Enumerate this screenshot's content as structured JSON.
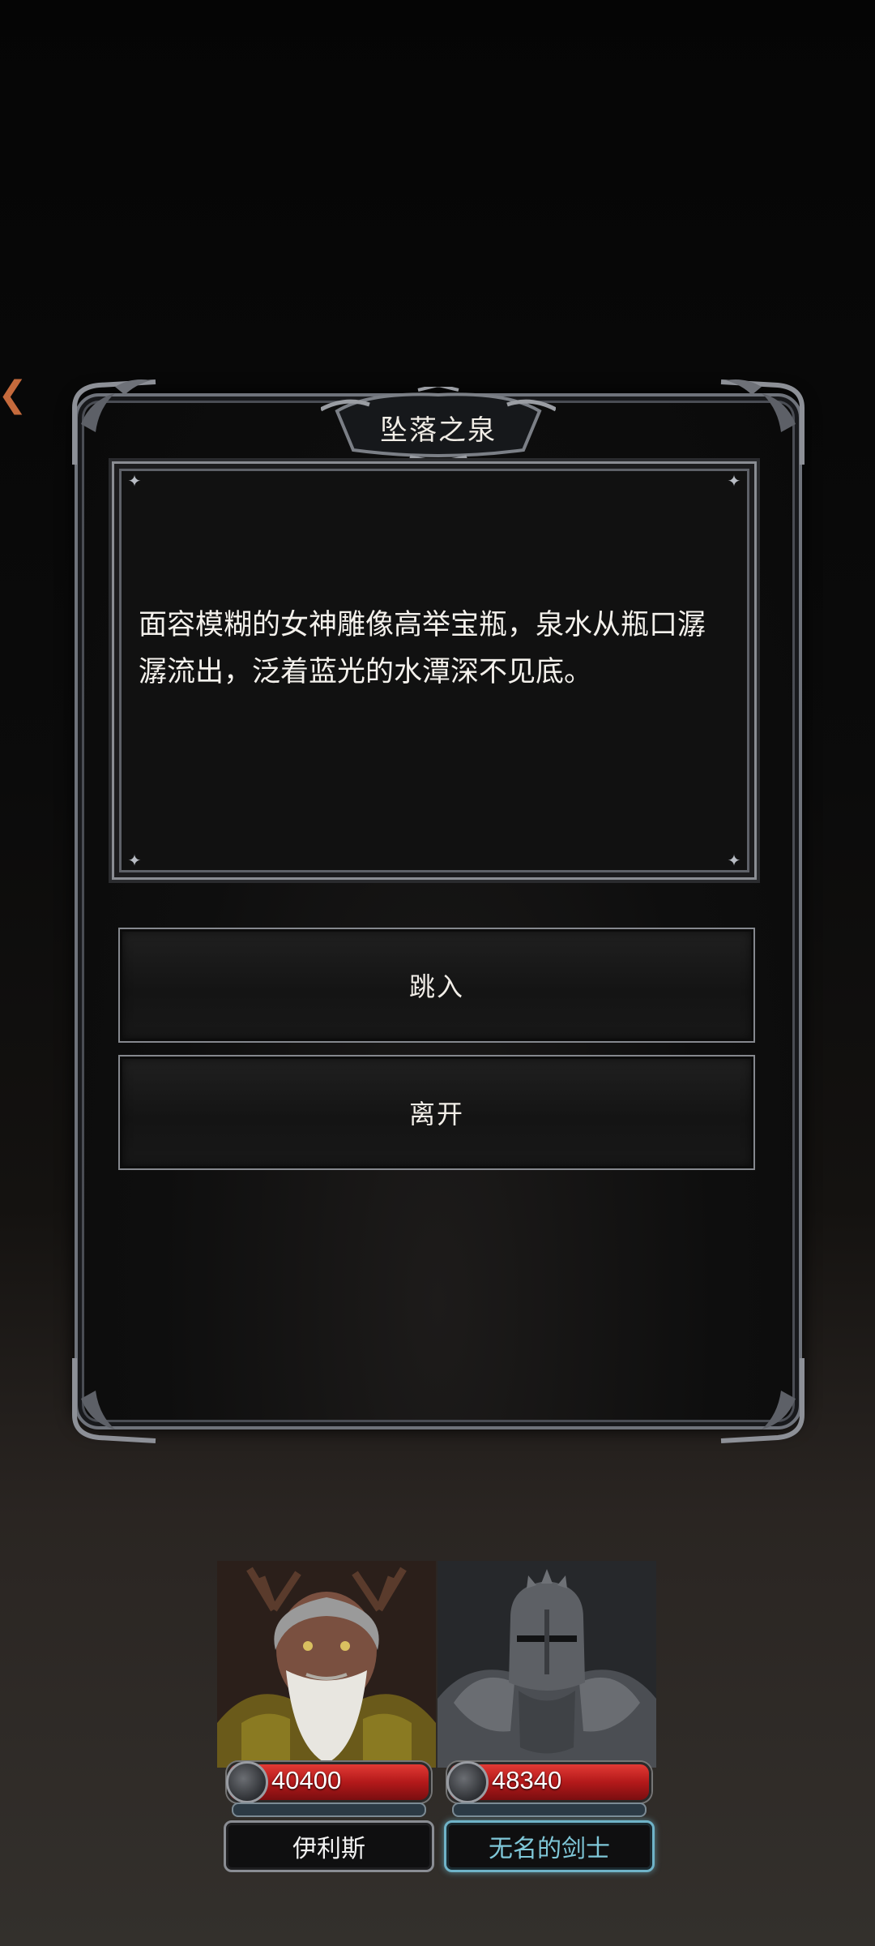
{
  "event": {
    "title": "坠落之泉",
    "description": "面容模糊的女神雕像高举宝瓶，泉水从瓶口潺潺流出，泛着蓝光的水潭深不见底。",
    "options": [
      {
        "label": "跳入"
      },
      {
        "label": "离开"
      }
    ]
  },
  "party": [
    {
      "name": "伊利斯",
      "hp": "40400",
      "selected": false,
      "portrait": "antlered-elder-portrait"
    },
    {
      "name": "无名的剑士",
      "hp": "48340",
      "selected": true,
      "portrait": "armored-knight-portrait"
    }
  ],
  "colors": {
    "hp_bar": "#c8201f",
    "selected_name": "#7fc7d8",
    "frame": "#8a8d93"
  }
}
